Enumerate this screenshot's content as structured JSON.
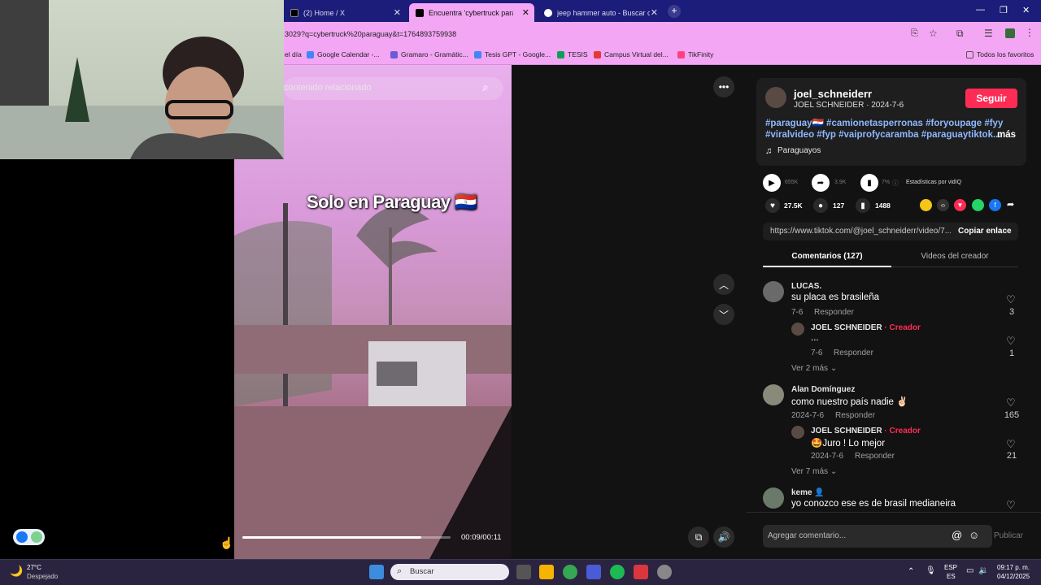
{
  "browser": {
    "tabs": [
      {
        "label": "(2) Home / X",
        "active": false
      },
      {
        "label": "Encuentra 'cybertruck para",
        "active": true
      },
      {
        "label": "jeep hammer auto - Buscar co",
        "active": false
      }
    ],
    "url": "3029?q=cybertruck%20paraguay&t=1764893759938",
    "bookmarks": [
      "el día",
      "Google Calendar -...",
      "Gramaro - Gramátic...",
      "Tesis GPT - Google...",
      "TESIS",
      "Campus Virtual del...",
      "TikFinity"
    ],
    "all_bookmarks": "Todos los favoritos"
  },
  "video": {
    "search_placeholder": "contenido relacionado",
    "caption": "Solo en Paraguay 🇵🇾",
    "time": "00:09/00:11",
    "progress": 0.86
  },
  "post": {
    "username": "joel_schneiderr",
    "subtitle": "JOEL SCHNEIDER · 2024-7-6",
    "follow_label": "Seguir",
    "hashtags": "#paraguay🇵🇾 #camionetasperronas #foryoupage #fyy #viralvideo #fyp #vaiprofycaramba #paraguaytiktok...",
    "more_label": "más",
    "sound": "Paraguayos",
    "stats": {
      "plays": "655K",
      "shares": "3.9K",
      "pct": "7%",
      "vidiq": "Estadísticas por vidIQ"
    },
    "likes": "27.5K",
    "comments": "127",
    "saves": "1488",
    "link": "https://www.tiktok.com/@joel_schneiderr/video/7...",
    "copy_label": "Copiar enlace"
  },
  "tabs": {
    "comments": "Comentarios (127)",
    "creator_videos": "Videos del creador"
  },
  "comments": [
    {
      "name": "LUCAS.",
      "text": "su placa es brasileña",
      "date": "7-6",
      "reply": "Responder",
      "likes": "3",
      "replies": [
        {
          "name": "JOEL SCHNEIDER",
          "badge": "· Creador",
          "text": "...",
          "date": "7-6",
          "reply": "Responder",
          "likes": "1"
        }
      ],
      "more": "Ver 2 más"
    },
    {
      "name": "Alan Domínguez",
      "text": "como nuestro país nadie ✌🏻",
      "date": "2024-7-6",
      "reply": "Responder",
      "likes": "165",
      "replies": [
        {
          "name": "JOEL SCHNEIDER",
          "badge": "· Creador",
          "text": "🤩Juro ! Lo mejor",
          "date": "2024-7-6",
          "reply": "Responder",
          "likes": "21"
        }
      ],
      "more": "Ver 7 más"
    },
    {
      "name": "keme 👤",
      "text": "yo conozco ese es de brasil medianeira"
    }
  ],
  "composer": {
    "placeholder": "Agregar comentario...",
    "publish": "Publicar"
  },
  "taskbar": {
    "weather_temp": "27°C",
    "weather_desc": "Despejado",
    "search": "Buscar",
    "lang1": "ESP",
    "lang2": "ES",
    "time": "09:17 p. m.",
    "date": "04/12/2025"
  },
  "colors": {
    "accent": "#fe2c55",
    "chrome": "#f3a6f3",
    "hashtag": "#8fb8ff"
  }
}
